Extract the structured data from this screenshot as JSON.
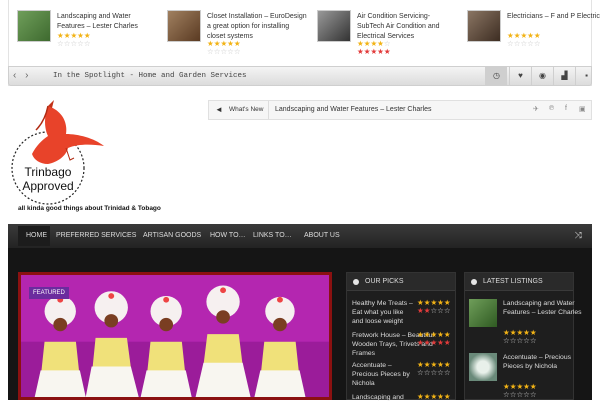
{
  "top_cards": [
    {
      "title": "Landscaping and Water Features – Lester Charles",
      "thumb_color": "#6f9e5a"
    },
    {
      "title": "Closet Installation – EuroDesign a great option for installing closet systems",
      "thumb_color": "#7a5a3a"
    },
    {
      "title": "Air Condition Servicing- SubTech Air Condition and Electrical Services",
      "thumb_color": "#5d5d5d"
    },
    {
      "title": "Electricians – F and P Electrical",
      "thumb_color": "#6b5a4b"
    }
  ],
  "spotlight": {
    "prev_icon": "chevron-left-icon",
    "next_icon": "chevron-right-icon",
    "text": "In the Spotlight - Home and Garden Services",
    "icons": [
      "clock-icon",
      "heart-icon",
      "eye-icon",
      "signal-icon",
      "chat-icon"
    ]
  },
  "logo": {
    "line1": "Trinbago",
    "line2": "Approved"
  },
  "tagline": "all kinda good things about Trinidad & Tobago",
  "ticker": {
    "label": "What's New",
    "headline": "Landscaping and Water Features – Lester Charles",
    "social": [
      "twitter-icon",
      "pinterest-icon",
      "facebook-icon",
      "instagram-icon"
    ]
  },
  "menu": {
    "items": [
      "HOME",
      "PREFERRED SERVICES",
      "ARTISAN GOODS",
      "HOW TO…",
      "LINKS TO…",
      "ABOUT US"
    ]
  },
  "featured": {
    "badge": "FEATURED"
  },
  "our_picks": {
    "heading": "OUR PICKS",
    "items": [
      {
        "title": "Healthy Me Treats – Eat what you like and loose weight"
      },
      {
        "title": "Fretwork House – Beautiful Wooden Trays, Trivets and Frames"
      },
      {
        "title": "Accentuate – Precious Pieces by Nichola"
      },
      {
        "title": "Landscaping and"
      }
    ]
  },
  "latest": {
    "heading": "LATEST LISTINGS",
    "items": [
      {
        "title": "Landscaping and Water Features – Lester Charles"
      },
      {
        "title": "Accentuate – Precious Pieces by Nichola"
      }
    ]
  }
}
